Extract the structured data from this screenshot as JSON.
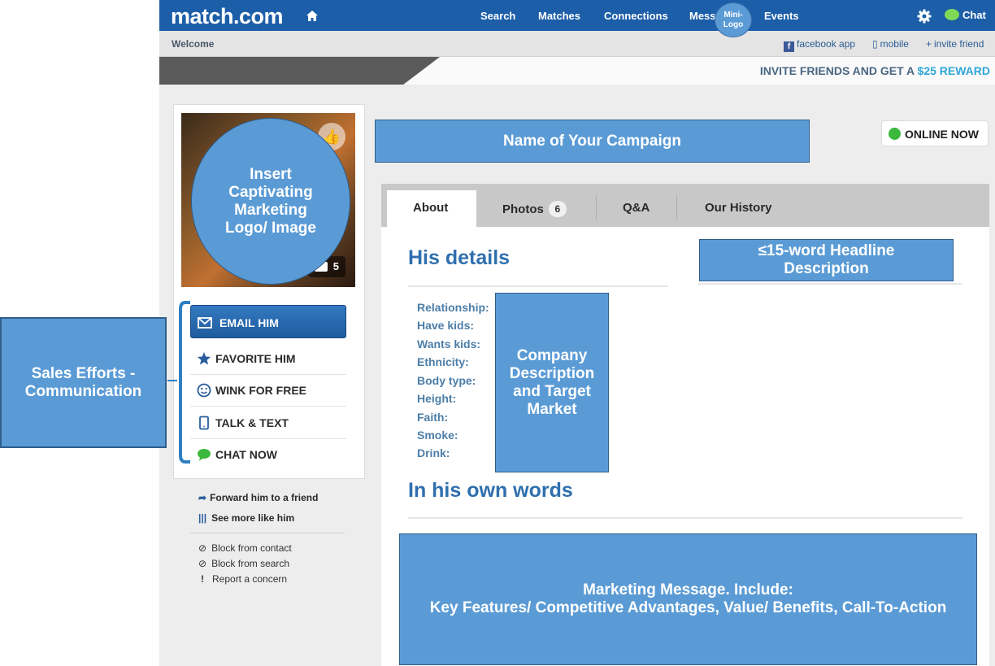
{
  "header": {
    "logo_text": "match.com",
    "nav": [
      "Search",
      "Matches",
      "Connections",
      "Messages",
      "Events"
    ],
    "mini_logo": "Mini-Logo",
    "chat_label": "Chat"
  },
  "subbar": {
    "welcome": "Welcome",
    "facebook": "facebook app",
    "mobile": "mobile",
    "invite": "invite friend"
  },
  "promo": {
    "text": "INVITE FRIENDS AND GET A",
    "amount": "$25 REWARD"
  },
  "profile": {
    "photo_count": "5",
    "online_status": "ONLINE NOW"
  },
  "actions": {
    "email": "EMAIL HIM",
    "favorite": "FAVORITE HIM",
    "wink": "WINK FOR FREE",
    "talk": "TALK & TEXT",
    "chat": "CHAT NOW"
  },
  "links": {
    "forward": "Forward him to a friend",
    "see_more": "See more like him",
    "block_contact": "Block from contact",
    "block_search": "Block from search",
    "report": "Report a concern"
  },
  "tabs": {
    "about": "About",
    "photos": "Photos",
    "photos_count": "6",
    "qa": "Q&A",
    "history": "Our History"
  },
  "details": {
    "title": "His details",
    "labels": [
      "Relationship:",
      "Have kids:",
      "Wants kids:",
      "Ethnicity:",
      "Body type:",
      "Height:",
      "Faith:",
      "Smoke:",
      "Drink:"
    ],
    "own_words_title": "In his own words"
  },
  "annotations": {
    "sales": "Sales Efforts - Communication",
    "campaign": "Name of Your Campaign",
    "logo": "Insert Captivating Marketing Logo/ Image",
    "headline": "≤15-word  Headline Description",
    "company": "Company Description and Target Market",
    "marketing_line1": "Marketing Message. Include:",
    "marketing_line2": "Key Features/ Competitive Advantages, Value/ Benefits, Call-To-Action"
  },
  "colors": {
    "nav_blue": "#1c5ea8",
    "annotation_blue": "#5b9bd5",
    "heading_blue": "#2f6fae",
    "reward_teal": "#2fa7d9",
    "online_green": "#3cb83c"
  }
}
